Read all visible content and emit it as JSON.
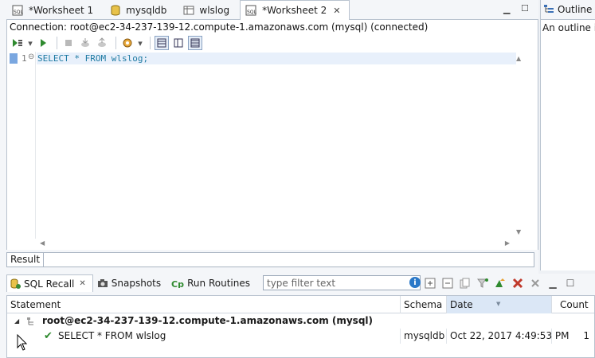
{
  "editor_tabs": [
    {
      "label": "*Worksheet 1",
      "icon": "sql-worksheet-icon",
      "active": false
    },
    {
      "label": "mysqldb",
      "icon": "database-icon",
      "active": false
    },
    {
      "label": "wlslog",
      "icon": "table-icon",
      "active": false
    },
    {
      "label": "*Worksheet 2",
      "icon": "sql-worksheet-icon",
      "active": true
    }
  ],
  "connection": {
    "text": "Connection: root@ec2-34-237-139-12.compute-1.amazonaws.com (mysql) (connected)"
  },
  "editor": {
    "line_number": "1",
    "code_keyword1": "SELECT",
    "code_star": " * ",
    "code_keyword2": "FROM",
    "code_table": " wlslog;"
  },
  "result_bar": {
    "label": "Result"
  },
  "outline": {
    "title": "Outline",
    "body_text": "An outline is"
  },
  "bottom_tabs": [
    {
      "label": "SQL Recall",
      "icon": "sql-recall-icon",
      "active": true
    },
    {
      "label": "Snapshots",
      "icon": "camera-icon",
      "active": false
    },
    {
      "label": "Run Routines",
      "icon": "run-routines-icon",
      "active": false
    }
  ],
  "filter": {
    "placeholder": "type filter text"
  },
  "grid": {
    "columns": [
      "Statement",
      "Schema",
      "Date",
      "Count"
    ],
    "group_row": {
      "statement": "root@ec2-34-237-139-12.compute-1.amazonaws.com (mysql)"
    },
    "rows": [
      {
        "statement": "SELECT * FROM wlslog",
        "schema": "mysqldb",
        "date": "Oct 22, 2017 4:49:53 PM",
        "count": "1"
      }
    ]
  },
  "colors": {
    "accent": "#2a78c8",
    "keyword": "#1e7aa3",
    "success": "#2f8a2f",
    "delete": "#c0392b"
  }
}
